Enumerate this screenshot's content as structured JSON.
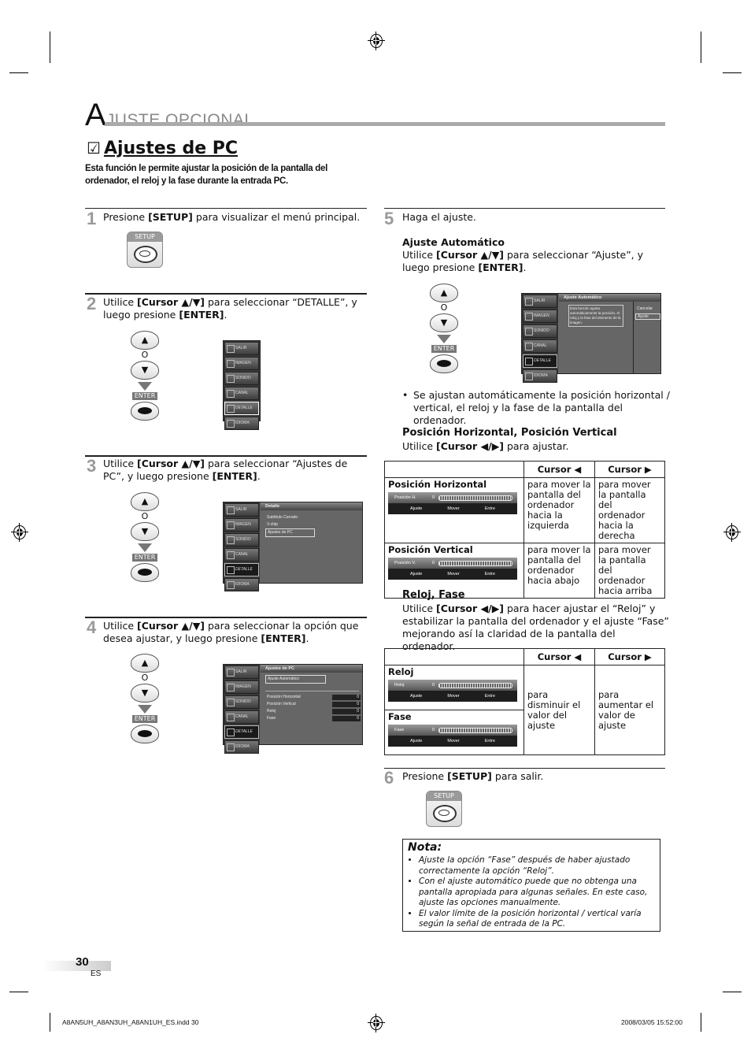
{
  "header": {
    "section_initial": "A",
    "section_rest": "JUSTE  OPCIONAL",
    "subsection_check": "☑",
    "subsection_title": "Ajustes de PC",
    "intro": "Esta función le permite ajustar la posición de la pantalla del ordenador, el reloj y la fase durante la entrada PC."
  },
  "remote": {
    "setup_label": "SETUP",
    "or_label": "O",
    "enter_label": "ENTER",
    "up": "▲",
    "down": "▼"
  },
  "osd": {
    "menu_items": [
      "SALIR",
      "IMAGEN",
      "SONIDO",
      "CANAL",
      "DETALLE",
      "IDIOMA"
    ],
    "detalle": {
      "title": "Detalle",
      "rows": [
        "Subtítulo Cerrado",
        "V-chip",
        "Ajustes de PC"
      ]
    },
    "ajustes_pc": {
      "title": "Ajustes de PC",
      "auto": "Ajuste Automático",
      "rows": [
        {
          "label": "Posición Horizontal",
          "value": "0"
        },
        {
          "label": "Posición Vertical",
          "value": "0"
        },
        {
          "label": "Reloj",
          "value": "0"
        },
        {
          "label": "Fase",
          "value": "0"
        }
      ]
    },
    "auto_adjust": {
      "title": "Ajuste Automático",
      "description": "Esta función ajusta automáticamente la posición, el reloj y la fase del elemento de la imagen.",
      "options": [
        "Cancelar",
        "Ajuste"
      ]
    }
  },
  "steps": [
    {
      "num": "1",
      "pre": "Presione ",
      "key": "[SETUP]",
      "post": " para visualizar el menú principal."
    },
    {
      "num": "2",
      "pre": "Utilice ",
      "key": "[Cursor ▲/▼]",
      "post": " para seleccionar “DETALLE”, y luego presione ",
      "key2": "[ENTER]",
      "post2": "."
    },
    {
      "num": "3",
      "pre": "Utilice ",
      "key": "[Cursor ▲/▼]",
      "post": " para seleccionar “Ajustes de PC”, y luego presione ",
      "key2": "[ENTER]",
      "post2": "."
    },
    {
      "num": "4",
      "pre": "Utilice ",
      "key": "[Cursor ▲/▼]",
      "post": " para seleccionar la opción que desea ajustar, y luego presione ",
      "key2": "[ENTER]",
      "post2": "."
    },
    {
      "num": "5",
      "text": "Haga el ajuste."
    },
    {
      "num": "6",
      "pre": "Presione ",
      "key": "[SETUP]",
      "post": " para salir."
    }
  ],
  "auto": {
    "heading": "Ajuste Automático",
    "pre": "Utilice ",
    "key": "[Cursor ▲/▼]",
    "post": " para seleccionar “Ajuste”, y luego presione ",
    "key2": "[ENTER]",
    "post2": ".",
    "bullet": "Se ajustan automáticamente la posición horizontal / vertical, el reloj y la fase de la pantalla del ordenador."
  },
  "position": {
    "heading": "Posición Horizontal, Posición Vertical",
    "pre": "Utilice ",
    "key": "[Cursor ◀/▶]",
    "post": " para ajustar.",
    "col_left": "Cursor ◀",
    "col_right": "Cursor ▶",
    "rows": [
      {
        "label": "Posición Horizontal",
        "bar_label": "Posición H.",
        "left": "para mover la pantalla del ordenador hacia la izquierda",
        "right": "para mover la pantalla del ordenador hacia la derecha"
      },
      {
        "label": "Posición Vertical",
        "bar_label": "Posición V.",
        "left": "para mover la pantalla del ordenador hacia abajo",
        "right": "para mover la pantalla del ordenador hacia arriba"
      }
    ]
  },
  "clock": {
    "heading": "Reloj, Fase",
    "pre": "Utilice ",
    "key": "[Cursor ◀/▶]",
    "post": " para hacer ajustar el “Reloj” y estabilizar la pantalla del ordenador y el ajuste “Fase” mejorando así la claridad de la pantalla del ordenador.",
    "col_left": "Cursor ◀",
    "col_right": "Cursor ▶",
    "rows": [
      {
        "label": "Reloj",
        "bar_label": "Reloj"
      },
      {
        "label": "Fase",
        "bar_label": "Fase"
      }
    ],
    "left": "para disminuir el valor del ajuste",
    "right": "para aumentar el valor de ajuste"
  },
  "bar_common": {
    "zero": "0",
    "ajuste": "Ajuste",
    "mover": "Mover",
    "entre": "Entre"
  },
  "nota": {
    "heading": "Nota:",
    "items": [
      "Ajuste la opción “Fase” después de haber ajustado correctamente la opción “Reloj”.",
      "Con el ajuste automático puede que no obtenga una pantalla apropiada para algunas señales. En este caso, ajuste las opciones manualmente.",
      "El valor límite de la posición horizontal / vertical varía según la señal de entrada de la PC."
    ]
  },
  "page": {
    "number": "30",
    "lang": "ES"
  },
  "footer": {
    "file": "A8AN5UH_A8AN3UH_A8AN1UH_ES.indd   30",
    "date": "2008/03/05   15:52:00"
  }
}
